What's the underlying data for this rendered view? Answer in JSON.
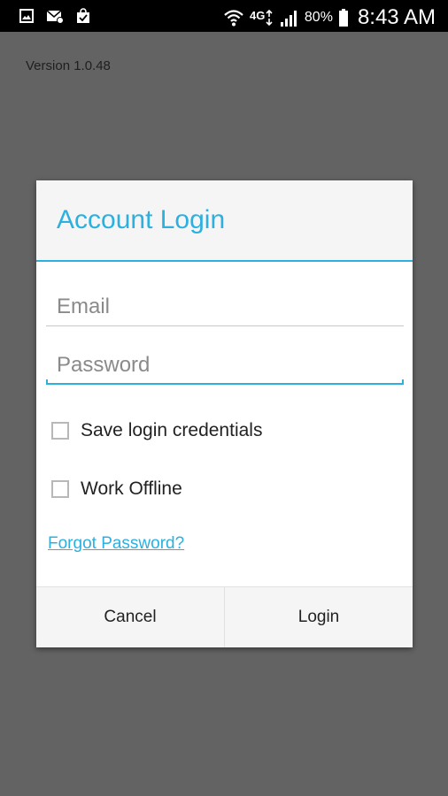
{
  "status_bar": {
    "left_icons": [
      "image-icon",
      "mail-icon",
      "shopping-bag-icon"
    ],
    "right_icons": [
      "wifi-icon",
      "lte-icon",
      "signal-icon",
      "battery-icon"
    ],
    "network": "4G",
    "battery": "80%",
    "time": "8:43 AM"
  },
  "version_text": "Version 1.0.48",
  "dialog": {
    "title": "Account Login",
    "email_placeholder": "Email",
    "email_value": "",
    "password_placeholder": "Password",
    "password_value": "",
    "save_credentials_label": "Save login credentials",
    "save_credentials_checked": false,
    "work_offline_label": "Work Offline",
    "work_offline_checked": false,
    "forgot_link": "Forgot Password?",
    "cancel_label": "Cancel",
    "login_label": "Login"
  },
  "colors": {
    "accent": "#2bb0e0",
    "backdrop": "#636363",
    "status_bar": "#000000"
  }
}
